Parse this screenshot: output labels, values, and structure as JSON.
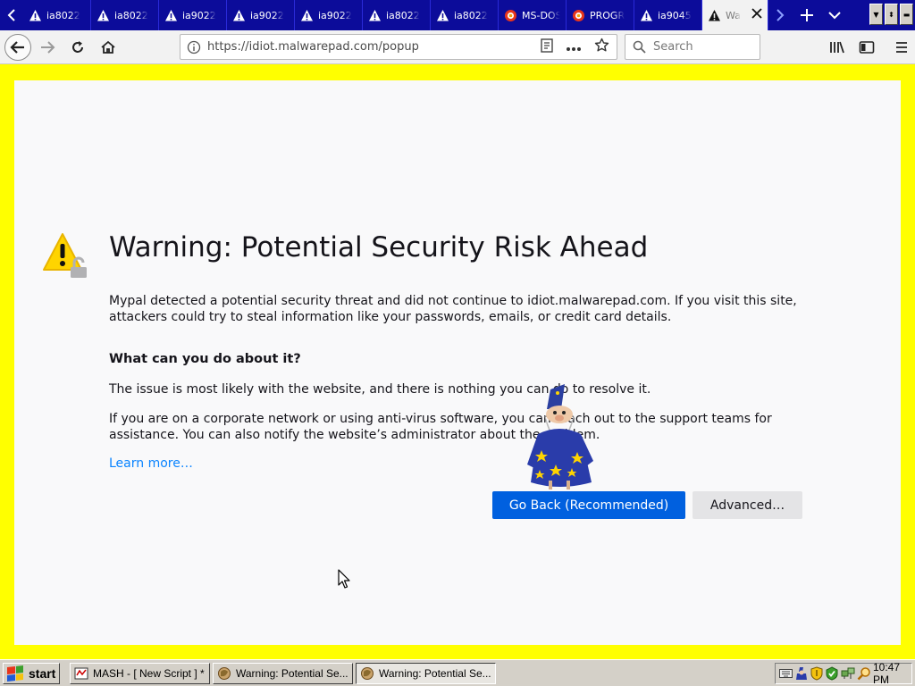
{
  "browser": {
    "tabs": [
      {
        "label": "ia8022",
        "icon": "warning-icon"
      },
      {
        "label": "ia8022",
        "icon": "warning-icon"
      },
      {
        "label": "ia9022",
        "icon": "warning-icon"
      },
      {
        "label": "ia9022",
        "icon": "warning-icon"
      },
      {
        "label": "ia9022",
        "icon": "warning-icon"
      },
      {
        "label": "ia8022",
        "icon": "warning-icon"
      },
      {
        "label": "ia8022",
        "icon": "warning-icon"
      },
      {
        "label": "MS-DOS",
        "icon": "brave-icon"
      },
      {
        "label": "PROGR",
        "icon": "brave-icon"
      },
      {
        "label": "ia9045",
        "icon": "warning-icon"
      },
      {
        "label": "Wa",
        "icon": "warning-icon",
        "active": true
      }
    ],
    "url": "https://idiot.malwarepad.com/popup",
    "search_placeholder": "Search"
  },
  "page": {
    "title": "Warning: Potential Security Risk Ahead",
    "intro": "Mypal detected a potential security threat and did not continue to idiot.malwarepad.com. If you visit this site, attackers could try to steal information like your passwords, emails, or credit card details.",
    "subheading": "What can you do about it?",
    "issue_text": "The issue is most likely with the website, and there is nothing you can do to resolve it.",
    "network_text": "If you are on a corporate network or using anti-virus software, you can reach out to the support teams for assistance. You can also notify the website’s administrator about the problem.",
    "learn_more": "Learn more…",
    "go_back_label": "Go Back (Recommended)",
    "advanced_label": "Advanced…"
  },
  "taskbar": {
    "start_label": "start",
    "tasks": [
      {
        "label": "MASH - [ New Script ] *"
      },
      {
        "label": "Warning: Potential Se..."
      },
      {
        "label": "Warning: Potential Se...",
        "pressed": true
      }
    ],
    "clock": "10:47 PM"
  },
  "colors": {
    "tab_strip": "#0c0c9a",
    "page_border": "#ffff00",
    "primary_button": "#0060df",
    "link": "#0a84ff"
  }
}
